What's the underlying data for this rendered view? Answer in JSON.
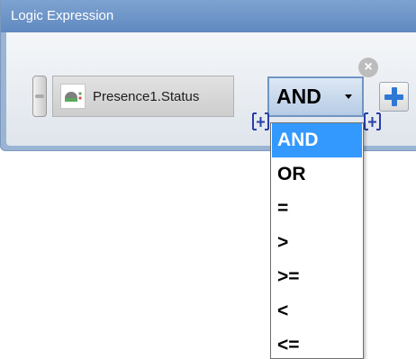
{
  "panel": {
    "title": "Logic Expression"
  },
  "operand": {
    "label": "Presence1.Status",
    "icon": "presence-sensor-icon"
  },
  "remove_button": {
    "symbol": "×",
    "icon": "close-circle-icon"
  },
  "operator": {
    "value": "AND",
    "options": [
      "AND",
      "OR",
      "=",
      ">",
      ">=",
      "<",
      "<="
    ],
    "selected_index": 0
  },
  "add_button": {
    "icon": "plus-icon"
  },
  "colors": {
    "panel_header": "#5f89c0",
    "combo_border": "#6f95c4",
    "selection": "#3399ff",
    "plus": "#2f78d4"
  }
}
